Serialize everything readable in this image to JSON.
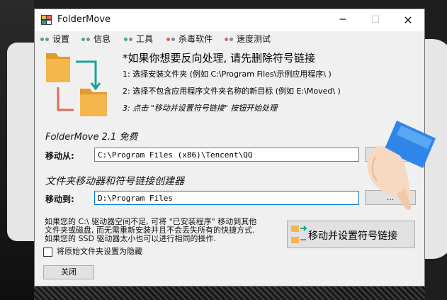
{
  "window": {
    "title": "FolderMove",
    "minimize_glyph": "─",
    "maximize_glyph": "☐",
    "close_glyph": "✕"
  },
  "menu": [
    {
      "label": "设置",
      "dot_colors": [
        "#3fae7c",
        "#7a8a9a"
      ]
    },
    {
      "label": "信息",
      "dot_colors": [
        "#3fae7c",
        "#7a8a9a"
      ]
    },
    {
      "label": "工具",
      "dot_colors": [
        "#3fae7c",
        "#7a8a9a"
      ]
    },
    {
      "label": "杀毒软件",
      "dot_colors": [
        "#e06060",
        "#7a8a9a"
      ]
    },
    {
      "label": "速度测试",
      "dot_colors": [
        "#e06060",
        "#7a8a9a"
      ]
    }
  ],
  "intro": {
    "headline": "*如果你想要反向处理, 请先删除符号链接",
    "step1": "1: 选择安装文件夹 (例如 C:\\Program Files\\示例应用程序\\ )",
    "step2": "2: 选择不包含应用程序文件夹名称的新目标 (例如 E:\\Moved\\ )",
    "step3": "3: 点击 \"移动并设置符号链接\" 按钮开始处理"
  },
  "section1_title": "FolderMove 2.1 免费",
  "section2_title": "文件夹移动器和符号链接创建器",
  "move_from": {
    "label": "移动从:",
    "value": "C:\\Program Files (x86)\\Tencent\\QQ",
    "browse_label": "..."
  },
  "move_to": {
    "label": "移动到:",
    "value": "D:\\Program Files",
    "browse_label": "..."
  },
  "description": {
    "line1": "如果您的 C:\\ 驱动器空间不足, 可将 \"已安装程序\" 移动到其他",
    "line2": "文件夹或磁盘, 而无需重新安装并且不会丢失所有的快捷方式.",
    "line3": "如果您的 SSD 驱动器太小也可以进行相同的操作."
  },
  "hide_checkbox": {
    "label": "将原始文件夹设置为隐藏",
    "checked": false
  },
  "close_button": "关闭",
  "move_button": "移动并设置符号链接",
  "colors": {
    "folder": "#f5b64d",
    "folder_tab": "#e39a2e",
    "arrow_teal": "#1aa39a",
    "arrow_red": "#e06a5a",
    "input_focus": "#0078d7"
  }
}
